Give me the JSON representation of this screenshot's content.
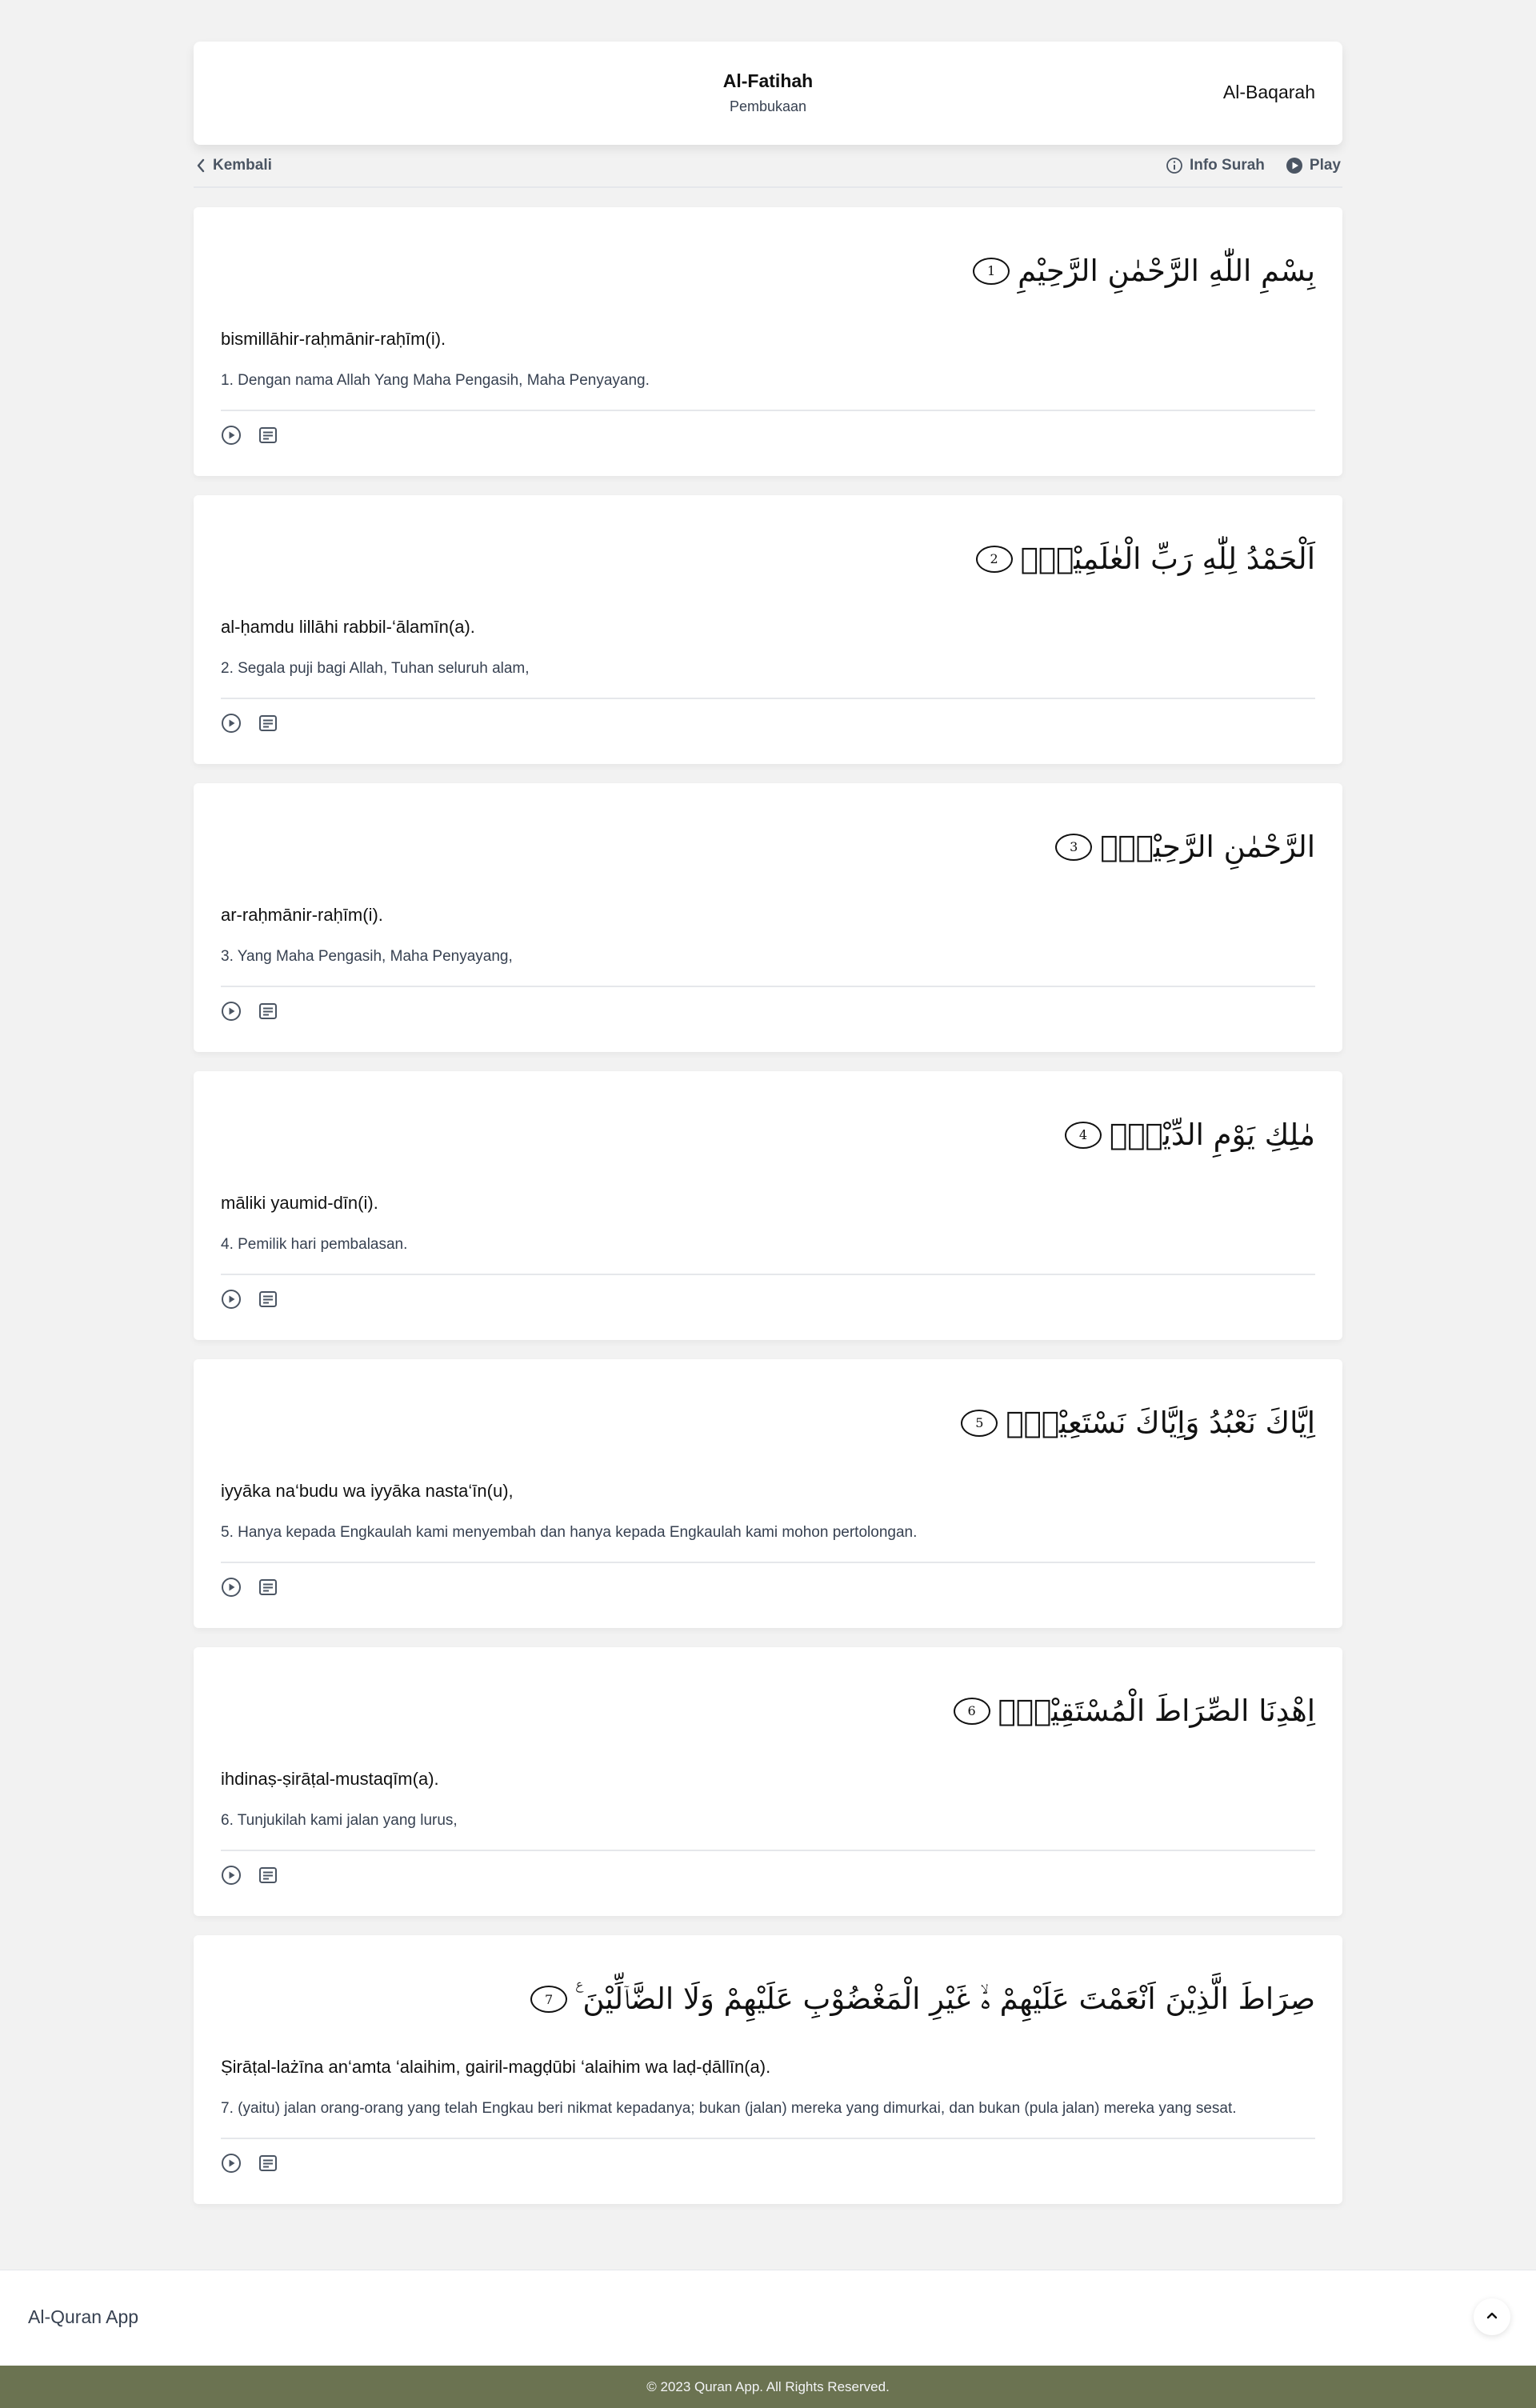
{
  "header": {
    "surah_name": "Al-Fatihah",
    "surah_meaning": "Pembukaan",
    "next_surah": "Al-Baqarah"
  },
  "toolbar": {
    "back_label": "Kembali",
    "info_label": "Info Surah",
    "play_label": "Play"
  },
  "ayahs": [
    {
      "number": "1",
      "arabic": "بِسْمِ اللّٰهِ الرَّحْمٰنِ الرَّحِيْمِ",
      "latin": "bismillāhir-raḥmānir-raḥīm(i).",
      "translation": "1. Dengan nama Allah Yang Maha Pengasih, Maha Penyayang."
    },
    {
      "number": "2",
      "arabic": "اَلْحَمْدُ لِلّٰهِ رَبِّ الْعٰلَمِيْنَۙ",
      "latin": "al-ḥamdu lillāhi rabbil-‘ālamīn(a).",
      "translation": "2. Segala puji bagi Allah, Tuhan seluruh alam,"
    },
    {
      "number": "3",
      "arabic": "الرَّحْمٰنِ الرَّحِيْمِۙ",
      "latin": "ar-raḥmānir-raḥīm(i).",
      "translation": "3. Yang Maha Pengasih, Maha Penyayang,"
    },
    {
      "number": "4",
      "arabic": "مٰلِكِ يَوْمِ الدِّيْنِۗ",
      "latin": "māliki yaumid-dīn(i).",
      "translation": "4. Pemilik hari pembalasan."
    },
    {
      "number": "5",
      "arabic": "اِيَّاكَ نَعْبُدُ وَاِيَّاكَ نَسْتَعِيْنُۗ",
      "latin": "iyyāka na‘budu wa iyyāka nasta‘īn(u),",
      "translation": "5. Hanya kepada Engkaulah kami menyembah dan hanya kepada Engkaulah kami mohon pertolongan."
    },
    {
      "number": "6",
      "arabic": "اِهْدِنَا الصِّرَاطَ الْمُسْتَقِيْمَۙ",
      "latin": "ihdinaṣ-ṣirāṭal-mustaqīm(a).",
      "translation": "6. Tunjukilah kami jalan yang lurus,"
    },
    {
      "number": "7",
      "arabic": "صِرَاطَ الَّذِيْنَ اَنْعَمْتَ عَلَيْهِمْ ەۙ غَيْرِ الْمَغْضُوْبِ عَلَيْهِمْ وَلَا الضَّاۤلِّيْنَ ࣖ",
      "latin": "Ṣirāṭal-lażīna an‘amta ‘alaihim, gairil-magḍūbi ‘alaihim wa laḍ-ḍāllīn(a).",
      "translation": "7. (yaitu) jalan orang-orang yang telah Engkau beri nikmat kepadanya; bukan (jalan) mereka yang dimurkai, dan bukan (pula jalan) mereka yang sesat."
    }
  ],
  "footer": {
    "brand": "Al-Quran App",
    "copyright": "© 2023 Quran App. All Rights Reserved."
  },
  "icons": {
    "back": "chevron-left-icon",
    "info": "info-circle-icon",
    "play": "play-circle-icon",
    "ayah_play": "play-circle-icon",
    "ayah_tafsir": "document-lines-icon",
    "to_top": "chevron-up-icon"
  },
  "colors": {
    "background": "#f2f2f2",
    "card": "#ffffff",
    "copyright_bar": "#6b7351",
    "muted_text": "#4b5563"
  }
}
